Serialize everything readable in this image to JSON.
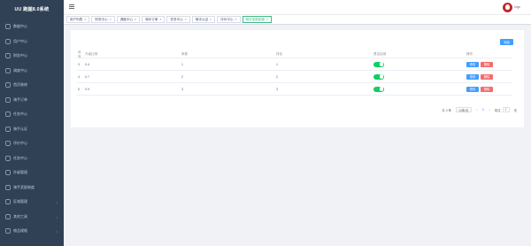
{
  "app": {
    "title": "UU 跑腿8.0系统"
  },
  "sidebar": {
    "items": [
      {
        "label": "数据中心",
        "icon": "dashboard-icon",
        "arrow": false
      },
      {
        "label": "用户中心",
        "icon": "user-icon",
        "arrow": false
      },
      {
        "label": "财务中心",
        "icon": "finance-icon",
        "arrow": false
      },
      {
        "label": "调度中心",
        "icon": "dispatch-icon",
        "arrow": false
      },
      {
        "label": "首页装修",
        "icon": "home-design-icon",
        "arrow": false
      },
      {
        "label": "骑手订单",
        "icon": "rider-order-icon",
        "arrow": false
      },
      {
        "label": "任务中心",
        "icon": "task-icon",
        "arrow": false
      },
      {
        "label": "骑手认证",
        "icon": "rider-auth-icon",
        "arrow": false
      },
      {
        "label": "评价中心",
        "icon": "review-icon",
        "arrow": false
      },
      {
        "label": "任务中心",
        "icon": "task-center-icon",
        "arrow": false
      },
      {
        "label": "升级管理",
        "icon": "upgrade-icon",
        "arrow": false
      },
      {
        "label": "骑手奖励制度",
        "icon": "reward-icon",
        "arrow": false
      },
      {
        "label": "区域管理",
        "icon": "region-icon",
        "arrow": true
      },
      {
        "label": "其他工具",
        "icon": "tools-icon",
        "arrow": true
      },
      {
        "label": "物品规格",
        "icon": "goods-spec-icon",
        "arrow": true
      }
    ]
  },
  "header": {
    "username": "Inge"
  },
  "tags": [
    {
      "label": "用户列表",
      "active": false
    },
    {
      "label": "财务中心",
      "active": false
    },
    {
      "label": "调度中心",
      "active": false
    },
    {
      "label": "骑手订单",
      "active": false
    },
    {
      "label": "任务中心",
      "active": false
    },
    {
      "label": "骑手认证",
      "active": false
    },
    {
      "label": "评价中心",
      "active": false
    },
    {
      "label": "骑手奖励制度",
      "active": true
    }
  ],
  "table": {
    "add_label": "添加",
    "columns": [
      "序号",
      "升级比例",
      "单数",
      "排名",
      "是否启用",
      "操作"
    ],
    "rows": [
      {
        "index": "3",
        "ratio": "0.4",
        "orders": "1",
        "rank": "1",
        "enabled": true
      },
      {
        "index": "4",
        "ratio": "0.7",
        "orders": "2",
        "rank": "2",
        "enabled": true
      },
      {
        "index": "5",
        "ratio": "0.9",
        "orders": "3",
        "rank": "3",
        "enabled": true
      }
    ],
    "edit_label": "修改",
    "delete_label": "删除"
  },
  "pagination": {
    "total": "共 3 条",
    "page_size": "10条/页",
    "prev": "<",
    "current": "1",
    "next": ">",
    "goto": "前往",
    "goto_value": "1",
    "goto_suffix": "页"
  },
  "colors": {
    "sidebar_bg": "#304156",
    "primary": "#409eff",
    "danger": "#f56c6c",
    "switch_on": "#13ce66",
    "active_tag": "#42b983"
  }
}
